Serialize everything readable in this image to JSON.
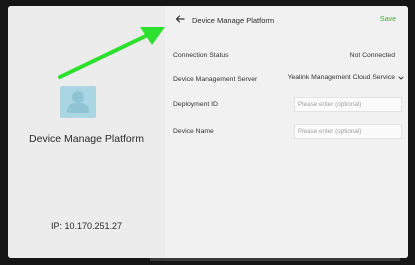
{
  "left_panel": {
    "title": "Device Manage Platform",
    "ip": "IP: 10.170.251.27"
  },
  "header": {
    "title": "Device Manage Platform",
    "save_label": "Save"
  },
  "rows": {
    "connection_status": {
      "label": "Connection Status",
      "value": "Not Connected"
    },
    "management_server": {
      "label": "Device Management Server",
      "value": "Yealink Management Cloud Service"
    },
    "deployment_id": {
      "label": "Deployment ID",
      "value": "",
      "placeholder": "Please enter (optional)"
    },
    "device_name": {
      "label": "Device Name",
      "value": "",
      "placeholder": "Please enter (optional)"
    }
  },
  "icons": [
    "back-arrow-icon",
    "chevron-down-icon",
    "device-icon"
  ],
  "colors": {
    "accent": "#3cab3c",
    "annotation_arrow": "#2ee02e"
  }
}
